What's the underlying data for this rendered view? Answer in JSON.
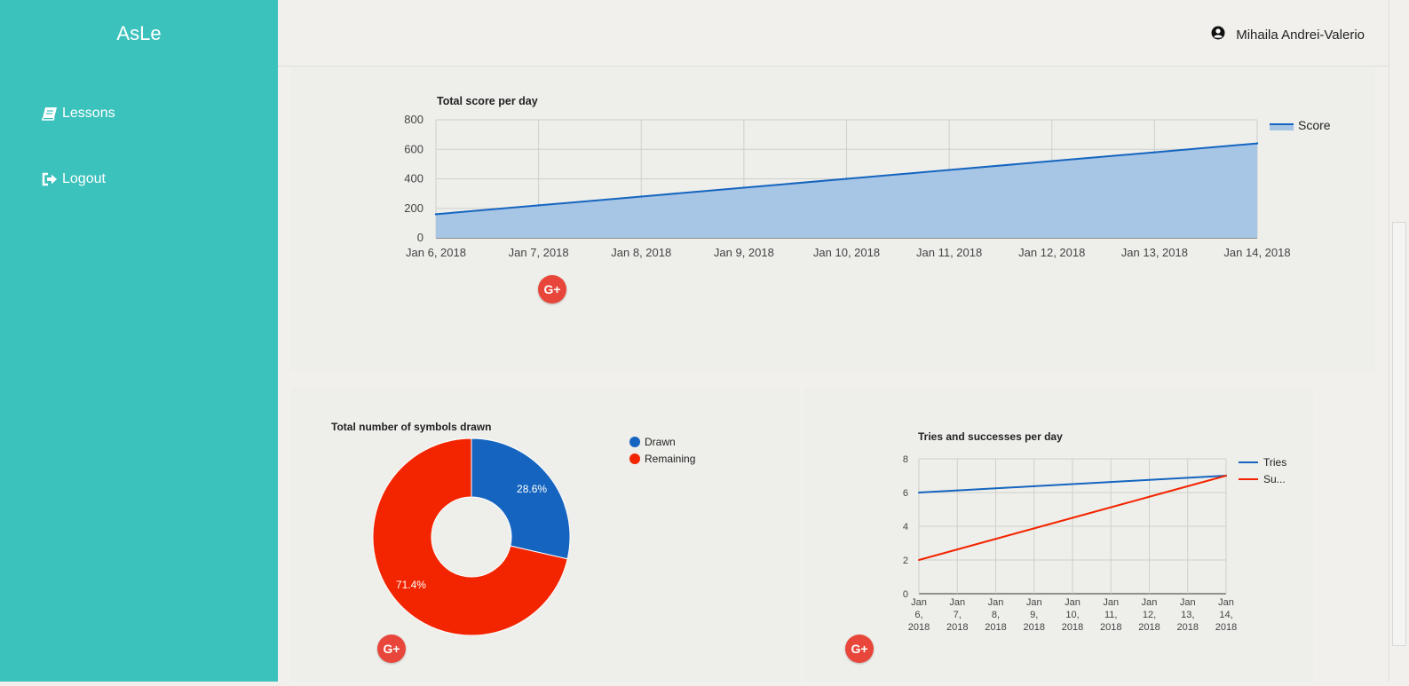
{
  "app": {
    "brand": "AsLe"
  },
  "sidebar": {
    "items": [
      {
        "label": "Lessons",
        "icon": "book-icon"
      },
      {
        "label": "Logout",
        "icon": "sign-out-icon"
      }
    ]
  },
  "header": {
    "user_name": "Mihaila Andrei-Valerio",
    "user_icon": "user-circle-icon"
  },
  "share_button": {
    "label": "G+",
    "icon": "google-plus-icon"
  },
  "colors": {
    "sidebar": "#3cc2bc",
    "blue": "#1565c0",
    "red": "#f32500",
    "area": "#a7c5e4"
  },
  "chart_data": [
    {
      "type": "area",
      "title": "Total score per day",
      "x": [
        "Jan 6, 2018",
        "Jan 7, 2018",
        "Jan 8, 2018",
        "Jan 9, 2018",
        "Jan 10, 2018",
        "Jan 11, 2018",
        "Jan 12, 2018",
        "Jan 13, 2018",
        "Jan 14, 2018"
      ],
      "series": [
        {
          "name": "Score",
          "values": [
            160,
            220,
            280,
            340,
            400,
            460,
            520,
            580,
            640
          ]
        }
      ],
      "ylim": [
        0,
        800
      ],
      "yticks": [
        "800",
        "600",
        "400",
        "200",
        "0"
      ],
      "grid": true,
      "legend": "right"
    },
    {
      "type": "pie",
      "title": "Total number of symbols drawn",
      "donut": true,
      "slices": [
        {
          "name": "Drawn",
          "value": 28.6,
          "label": "28.6%"
        },
        {
          "name": "Remaining",
          "value": 71.4,
          "label": "71.4%"
        }
      ],
      "legend": "right"
    },
    {
      "type": "line",
      "title": "Tries and successes per day",
      "x": [
        [
          "Jan",
          "6,",
          "2018"
        ],
        [
          "Jan",
          "7,",
          "2018"
        ],
        [
          "Jan",
          "8,",
          "2018"
        ],
        [
          "Jan",
          "9,",
          "2018"
        ],
        [
          "Jan",
          "10,",
          "2018"
        ],
        [
          "Jan",
          "11,",
          "2018"
        ],
        [
          "Jan",
          "12,",
          "2018"
        ],
        [
          "Jan",
          "13,",
          "2018"
        ],
        [
          "Jan",
          "14,",
          "2018"
        ]
      ],
      "series": [
        {
          "name": "Tries",
          "legend_label": "Tries",
          "values": [
            6,
            6.125,
            6.25,
            6.375,
            6.5,
            6.625,
            6.75,
            6.875,
            7
          ]
        },
        {
          "name": "Su...",
          "legend_label": "Su...",
          "values": [
            2,
            2.625,
            3.25,
            3.875,
            4.5,
            5.125,
            5.75,
            6.375,
            7
          ]
        }
      ],
      "ylim": [
        0,
        8
      ],
      "yticks": [
        "8",
        "6",
        "4",
        "2",
        "0"
      ],
      "grid": true,
      "legend": "right"
    }
  ]
}
